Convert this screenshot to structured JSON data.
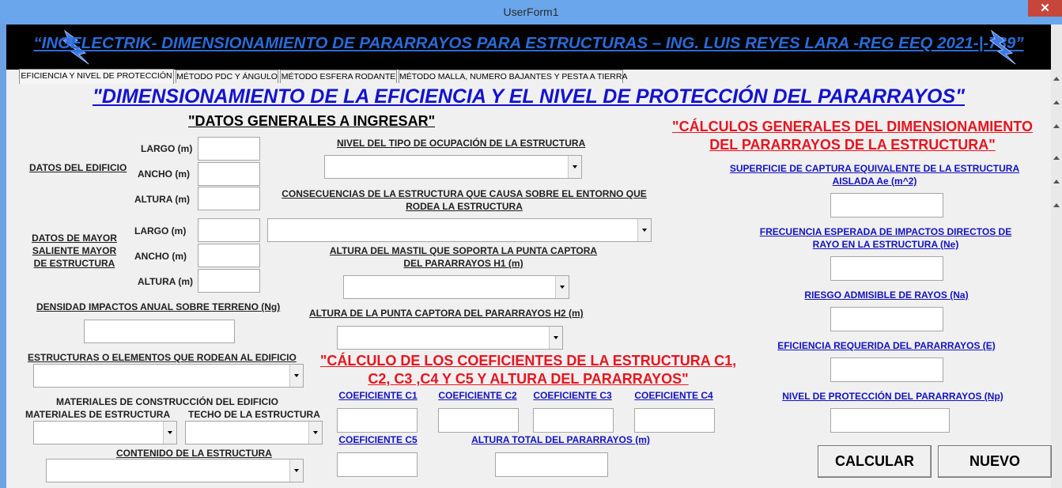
{
  "window": {
    "title": "UserForm1",
    "close_glyph": "✕"
  },
  "banner": {
    "text": "“INGELECTRIK- DIMENSIONAMIENTO DE PARARRAYOS PARA ESTRUCTURAS – ING. LUIS REYES LARA -REG EEQ 2021-|-789”",
    "icon": "lightning-bolt-icon"
  },
  "tabs": [
    {
      "label": "EFICIENCIA Y NIVEL DE PROTECCIÓN",
      "active": true
    },
    {
      "label": "MÉTODO PDC Y ÁNGULO"
    },
    {
      "label": "MÉTODO ESFERA RODANTE"
    },
    {
      "label": "MÉTODO MALLA, NUMERO BAJANTES Y PESTA A TIERRA"
    }
  ],
  "main_title": "\"DIMENSIONAMIENTO DE LA EFICIENCIA Y EL NIVEL DE PROTECCIÓN DEL PARARRAYOS\"",
  "datos": {
    "heading": "\"DATOS GENERALES A INGRESAR\"",
    "edificio_label": "DATOS DEL EDIFICIO",
    "saliente_label": "DATOS DE MAYOR SALIENTE MAYOR DE ESTRUCTURA",
    "largo": "LARGO (m)",
    "ancho": "ANCHO (m)",
    "altura": "ALTURA (m)",
    "densidad": "DENSIDAD IMPACTOS ANUAL SOBRE TERRENO (Ng)",
    "estructuras_rodean": "ESTRUCTURAS O ELEMENTOS QUE RODEAN AL EDIFICIO",
    "materiales_heading": "MATERIALES DE CONSTRUCCIÓN DEL EDIFICIO",
    "materiales_estructura": "MATERIALES DE ESTRUCTURA",
    "techo": "TECHO DE LA ESTRUCTURA",
    "contenido": "CONTENIDO DE LA ESTRUCTURA"
  },
  "middle": {
    "nivel_ocupacion": "NIVEL DEL TIPO DE OCUPACIÓN DE LA ESTRUCTURA",
    "consecuencias": "CONSECUENCIAS DE LA ESTRUCTURA QUE CAUSA SOBRE EL ENTORNO QUE RODEA LA ESTRUCTURA",
    "altura_mastil": "ALTURA DEL MASTIL QUE SOPORTA LA PUNTA CAPTORA DEL PARARRAYOS H1 (m)",
    "altura_punta": "ALTURA DE LA PUNTA CAPTORA DEL PARARRAYOS H2 (m)",
    "coef_heading": "\"CÁLCULO DE LOS COEFICIENTES DE LA ESTRUCTURA C1, C2, C3 ,C4 Y C5 Y ALTURA DEL PARARRAYOS\"",
    "c1": "COEFICIENTE C1",
    "c2": "COEFICIENTE C2",
    "c3": "COEFICIENTE C3",
    "c4": "COEFICIENTE C4",
    "c5": "COEFICIENTE C5",
    "altura_total": "ALTURA TOTAL DEL PARARRAYOS (m)"
  },
  "calculos": {
    "heading": "\"CÁLCULOS GENERALES DEL DIMENSIONAMIENTO DEL PARARRAYOS DE LA ESTRUCTURA\"",
    "superficie": "SUPERFICIE DE CAPTURA EQUIVALENTE DE LA ESTRUCTURA AISLADA Ae (m^2)",
    "frecuencia": "FRECUENCIA ESPERADA DE IMPACTOS DIRECTOS DE RAYO  EN LA ESTRUCTURA (Ne)",
    "riesgo": "RIESGO ADMISIBLE DE RAYOS (Na)",
    "eficiencia": "EFICIENCIA REQUERIDA DEL PARARRAYOS (E)",
    "nivel": "NIVEL DE PROTECCIÓN DEL PARARRAYOS (Np)"
  },
  "buttons": {
    "calcular": "CALCULAR",
    "nuevo": "NUEVO"
  }
}
